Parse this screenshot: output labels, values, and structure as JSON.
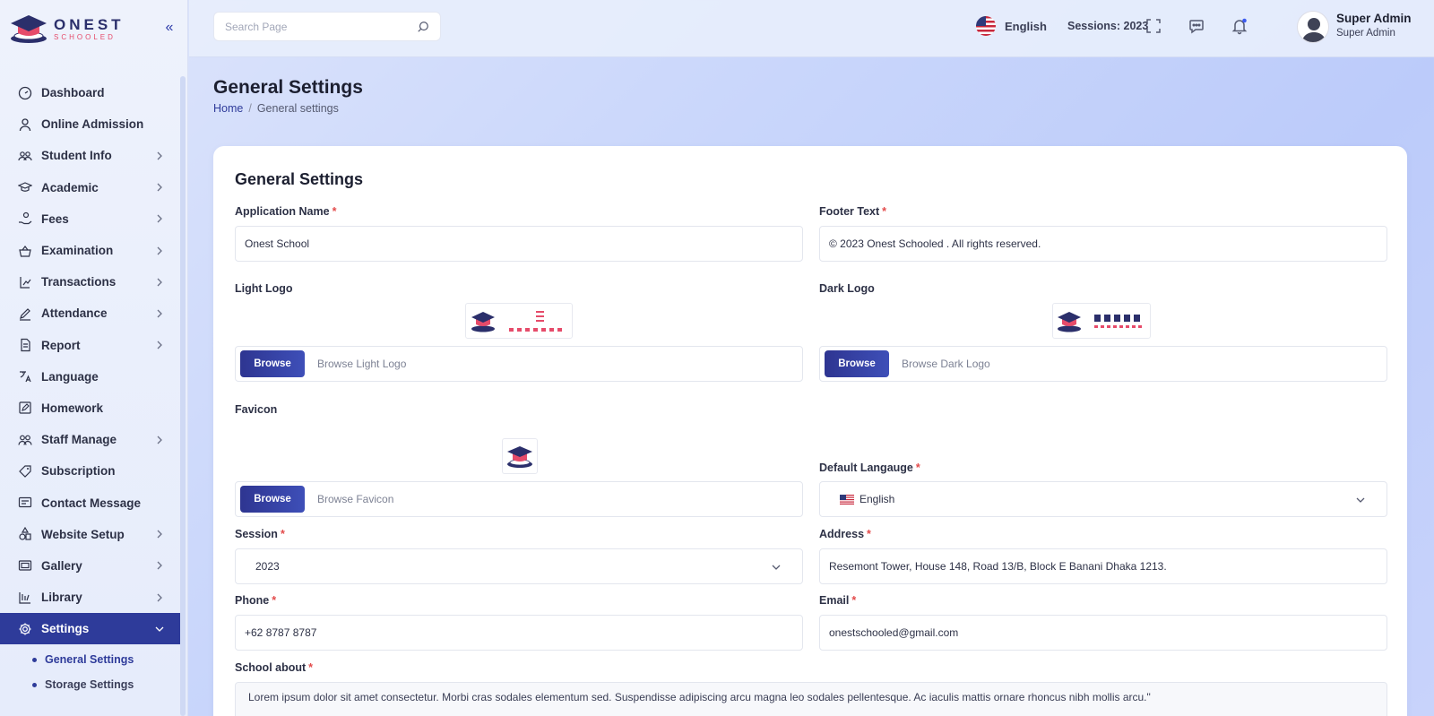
{
  "brand": {
    "name": "ONEST",
    "sub": "SCHOOLED"
  },
  "sidebar": {
    "items": [
      {
        "label": "Dashboard",
        "icon": "dashboard-icon",
        "expandable": false
      },
      {
        "label": "Online Admission",
        "icon": "user-icon",
        "expandable": false
      },
      {
        "label": "Student Info",
        "icon": "users-icon",
        "expandable": true
      },
      {
        "label": "Academic",
        "icon": "graduation-cap-icon",
        "expandable": true
      },
      {
        "label": "Fees",
        "icon": "hand-coin-icon",
        "expandable": true
      },
      {
        "label": "Examination",
        "icon": "basket-icon",
        "expandable": true
      },
      {
        "label": "Transactions",
        "icon": "transaction-icon",
        "expandable": true
      },
      {
        "label": "Attendance",
        "icon": "pen-icon",
        "expandable": true
      },
      {
        "label": "Report",
        "icon": "document-icon",
        "expandable": true
      },
      {
        "label": "Language",
        "icon": "translate-icon",
        "expandable": false
      },
      {
        "label": "Homework",
        "icon": "edit-box-icon",
        "expandable": false
      },
      {
        "label": "Staff Manage",
        "icon": "group-icon",
        "expandable": true
      },
      {
        "label": "Subscription",
        "icon": "tag-icon",
        "expandable": false
      },
      {
        "label": "Contact Message",
        "icon": "message-icon",
        "expandable": false
      },
      {
        "label": "Website Setup",
        "icon": "shapes-icon",
        "expandable": true
      },
      {
        "label": "Gallery",
        "icon": "gallery-icon",
        "expandable": true
      },
      {
        "label": "Library",
        "icon": "library-icon",
        "expandable": true
      },
      {
        "label": "Settings",
        "icon": "gear-icon",
        "expandable": true,
        "active": true
      }
    ],
    "sub_items": [
      {
        "label": "General Settings",
        "current": true
      },
      {
        "label": "Storage Settings",
        "current": false
      }
    ]
  },
  "header": {
    "search_placeholder": "Search Page",
    "language": "English",
    "sessions": "Sessions: 2023",
    "user_name": "Super Admin",
    "user_role": "Super Admin"
  },
  "page": {
    "title": "General Settings",
    "breadcrumb_home": "Home",
    "breadcrumb_sep": "/",
    "breadcrumb_current": "General settings"
  },
  "form": {
    "card_title": "General Settings",
    "required_mark": "*",
    "app_name_label": "Application Name",
    "app_name_value": "Onest School",
    "footer_label": "Footer Text",
    "footer_value": "© 2023 Onest Schooled . All rights reserved.",
    "light_logo_label": "Light Logo",
    "dark_logo_label": "Dark Logo",
    "favicon_label": "Favicon",
    "browse_label": "Browse",
    "browse_light_ph": "Browse Light Logo",
    "browse_dark_ph": "Browse Dark Logo",
    "browse_favicon_ph": "Browse Favicon",
    "default_lang_label": "Default Langauge",
    "default_lang_value": "English",
    "session_label": "Session",
    "session_value": "2023",
    "address_label": "Address",
    "address_value": "Resemont Tower, House 148, Road 13/B, Block E Banani Dhaka 1213.",
    "phone_label": "Phone",
    "phone_value": "+62 8787 8787",
    "email_label": "Email",
    "email_value": "onestschooled@gmail.com",
    "about_label": "School about",
    "about_value": "Lorem ipsum dolor sit amet consectetur. Morbi cras sodales elementum sed. Suspendisse adipiscing arcu magna leo sodales pellentesque. Ac iaculis mattis ornare rhoncus nibh mollis arcu.\""
  },
  "colors": {
    "primary": "#2e3b9a",
    "accent": "#e64b6a",
    "required": "#e34b4b"
  }
}
